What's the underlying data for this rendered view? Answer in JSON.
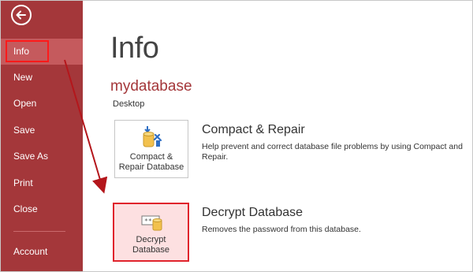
{
  "sidebar": {
    "back_icon": "back-arrow-icon",
    "items": [
      {
        "label": "Info",
        "active": true
      },
      {
        "label": "New"
      },
      {
        "label": "Open"
      },
      {
        "label": "Save"
      },
      {
        "label": "Save As"
      },
      {
        "label": "Print"
      },
      {
        "label": "Close"
      },
      {
        "label": "Account"
      }
    ]
  },
  "main": {
    "title": "Info",
    "database_name": "mydatabase",
    "database_location": "Desktop",
    "actions": [
      {
        "button_label_line1": "Compact &",
        "button_label_line2": "Repair Database",
        "title": "Compact & Repair",
        "description": "Help prevent and correct database file problems by using Compact and Repair.",
        "icon": "compact-repair-icon"
      },
      {
        "button_label_line1": "Decrypt",
        "button_label_line2": "Database",
        "title": "Decrypt Database",
        "description": "Removes the password from this database.",
        "icon": "decrypt-icon"
      }
    ]
  },
  "colors": {
    "sidebar": "#a4373a",
    "sidebar_active": "#c55a5d",
    "highlight": "#e0242c",
    "accent_text": "#a4373a"
  }
}
